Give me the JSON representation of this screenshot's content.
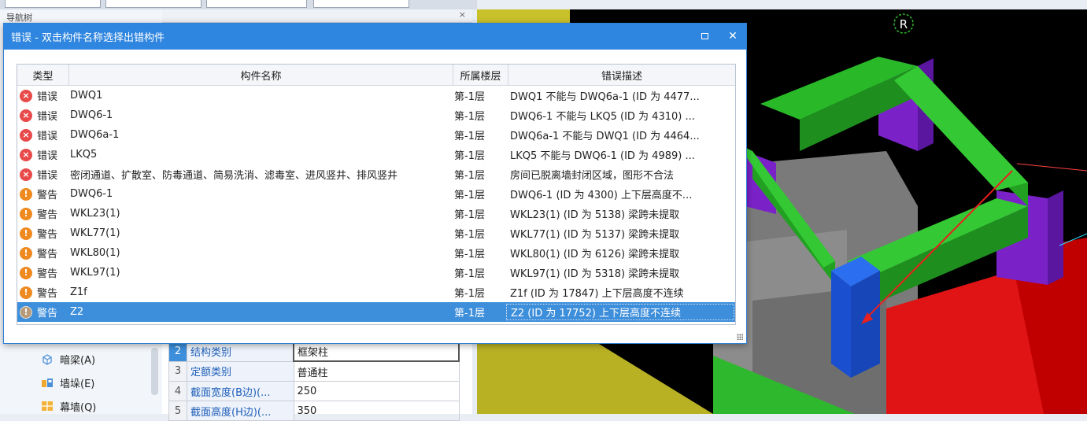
{
  "background": {
    "nav_title": "导航树",
    "nav_items": [
      {
        "label": "暗梁(A)",
        "icon": "hidden-beam-icon"
      },
      {
        "label": "墙垛(E)",
        "icon": "wall-pier-icon"
      },
      {
        "label": "幕墙(Q)",
        "icon": "curtain-wall-icon"
      }
    ],
    "close_glyph": "×",
    "properties": [
      {
        "num": "2",
        "name": "结构类别",
        "value": "框架柱"
      },
      {
        "num": "3",
        "name": "定额类别",
        "value": "普通柱"
      },
      {
        "num": "4",
        "name": "截面宽度(B边)(...",
        "value": "250"
      },
      {
        "num": "5",
        "name": "截面高度(H边)(...",
        "value": "350"
      }
    ],
    "viewport_label": "R"
  },
  "dialog": {
    "title": "错误 - 双击构件名称选择出错构件",
    "maximize_label": "",
    "close_label": "✕",
    "columns": [
      "类型",
      "构件名称",
      "所属楼层",
      "错误描述"
    ],
    "rows": [
      {
        "kind": "err",
        "type": "错误",
        "name": "DWQ1",
        "floor": "第-1层",
        "desc": "DWQ1 不能与 DWQ6a-1 (ID 为 4477..."
      },
      {
        "kind": "err",
        "type": "错误",
        "name": "DWQ6-1",
        "floor": "第-1层",
        "desc": "DWQ6-1 不能与 LKQ5 (ID 为 4310) ..."
      },
      {
        "kind": "err",
        "type": "错误",
        "name": "DWQ6a-1",
        "floor": "第-1层",
        "desc": "DWQ6a-1 不能与 DWQ1 (ID 为 4464..."
      },
      {
        "kind": "err",
        "type": "错误",
        "name": "LKQ5",
        "floor": "第-1层",
        "desc": "LKQ5 不能与 DWQ6-1 (ID 为 4989) ..."
      },
      {
        "kind": "err",
        "type": "错误",
        "name": "密闭通道、扩散室、防毒通道、简易洗消、滤毒室、进风竖井、排风竖井",
        "floor": "第-1层",
        "desc": "房间已脱离墙封闭区域，图形不合法"
      },
      {
        "kind": "warn",
        "type": "警告",
        "name": "DWQ6-1",
        "floor": "第-1层",
        "desc": "DWQ6-1 (ID 为 4300) 上下层高度不..."
      },
      {
        "kind": "warn",
        "type": "警告",
        "name": "WKL23(1)",
        "floor": "第-1层",
        "desc": "WKL23(1) (ID 为 5138) 梁跨未提取"
      },
      {
        "kind": "warn",
        "type": "警告",
        "name": "WKL77(1)",
        "floor": "第-1层",
        "desc": "WKL77(1) (ID 为 5137) 梁跨未提取"
      },
      {
        "kind": "warn",
        "type": "警告",
        "name": "WKL80(1)",
        "floor": "第-1层",
        "desc": "WKL80(1) (ID 为 6126) 梁跨未提取"
      },
      {
        "kind": "warn",
        "type": "警告",
        "name": "WKL97(1)",
        "floor": "第-1层",
        "desc": "WKL97(1) (ID 为 5318) 梁跨未提取"
      },
      {
        "kind": "warn",
        "type": "警告",
        "name": "Z1f",
        "floor": "第-1层",
        "desc": "Z1f (ID 为 17847) 上下层高度不连续"
      },
      {
        "kind": "warn",
        "type": "警告",
        "name": "Z2",
        "floor": "第-1层",
        "desc": "Z2 (ID 为 17752) 上下层高度不连续",
        "selected": true
      }
    ],
    "error_glyph": "×",
    "warn_glyph": "!"
  },
  "colors": {
    "title_bar": "#2f86e0",
    "selection": "#3d8edb",
    "error": "#e84a4a",
    "warning": "#ee8a1f"
  }
}
